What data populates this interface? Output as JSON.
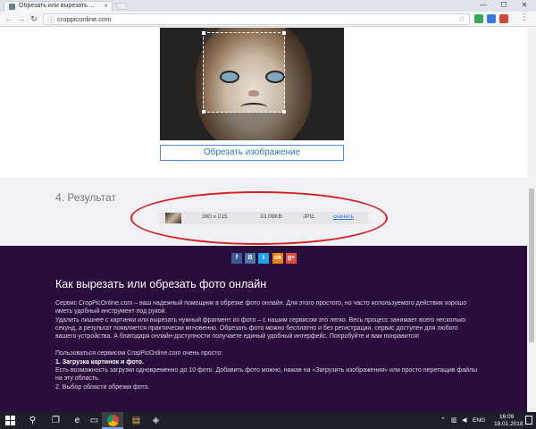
{
  "browser": {
    "tab_title": "Обрезать или вырезать ...",
    "tab_close": "×",
    "url": "croppiconline.com",
    "min": "—",
    "max": "☐",
    "close": "✕",
    "back": "←",
    "forward": "→",
    "reload": "↻",
    "star": "☆",
    "menu": "⋮"
  },
  "crop": {
    "button_label": "Обрезать изображение"
  },
  "result": {
    "title": "4. Результат",
    "dimensions": "360 x 215",
    "size": "33.08KB",
    "format": "JPG",
    "download": "скачать"
  },
  "social": [
    "f",
    "B",
    "t",
    "ok",
    "g+"
  ],
  "info": {
    "title": "Как вырезать или обрезать фото онлайн",
    "p1": "Сервис CropPicOnline.com – ваш надежный помощник в обрезке фото онлайн. Для этого простого, но часто используемого действия хорошо иметь удобный инструмент под рукой.",
    "p2": "Удалить лишнее с картинки или вырезать нужный фрагмент из фото – с нашим сервисом это легко. Весь процесс занимает всего несколько секунд, а результат появляется практически мгновенно. Обрезать фото можно бесплатно и без регистрации, сервис доступен для любого вашего устройства. А благодаря онлайн-доступности получаете единый удобный интерфейс. Попробуйте и вам понравится!",
    "p3": "Пользоваться сервисом CropPicOnline.com очень просто:",
    "step1_title": "1. Загрузка картинок и фото.",
    "step1_text": "Есть возможность загрузки одновременно до 10 фото. Добавить фото можно, нажав на «Загрузить изображения» или просто перетащив файлы на эту область.",
    "step2_partial": "2. Выбор области обрезки фото."
  },
  "taskbar": {
    "lang": "ENG",
    "time": "16:09",
    "date": "18.01.2018"
  }
}
